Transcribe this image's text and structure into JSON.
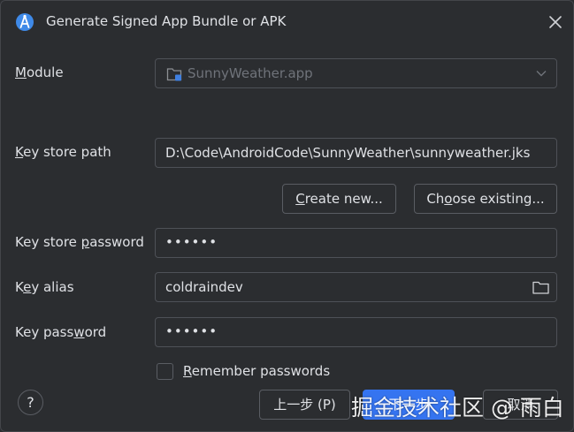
{
  "window": {
    "title": "Generate Signed App Bundle or APK",
    "icon": "android-studio-icon"
  },
  "module": {
    "label_mnemonic": "M",
    "label_rest": "odule",
    "value": "SunnyWeather.app",
    "icon": "module-folder-icon"
  },
  "keystore_path": {
    "label_mnemonic": "K",
    "label_rest": "ey store path",
    "value": "D:\\Code\\AndroidCode\\SunnyWeather\\sunnyweather.jks"
  },
  "buttons": {
    "create_mnemonic": "C",
    "create_rest": "reate new...",
    "choose_pre": "Ch",
    "choose_mnemonic": "o",
    "choose_rest": "ose existing...",
    "prev": "上一步 (P)",
    "next": "下一步",
    "cancel": "取消",
    "help": "?"
  },
  "keystore_password": {
    "label_pre": "Key store ",
    "label_mnemonic": "p",
    "label_rest": "assword",
    "value": "••••••"
  },
  "key_alias": {
    "label_pre": "K",
    "label_mnemonic": "e",
    "label_rest": "y alias",
    "value": "coldraindev"
  },
  "key_password": {
    "label_pre": "Key pass",
    "label_mnemonic": "w",
    "label_rest": "ord",
    "value": "••••••"
  },
  "remember": {
    "label_mnemonic": "R",
    "label_rest": "emember passwords",
    "checked": false
  },
  "watermark": "掘金技术社区 @ 雨白",
  "colors": {
    "background": "#2b2d30",
    "border": "#4e5157",
    "text": "#dfe1e5",
    "disabled_text": "#6f737a",
    "accent": "#3574f0"
  }
}
